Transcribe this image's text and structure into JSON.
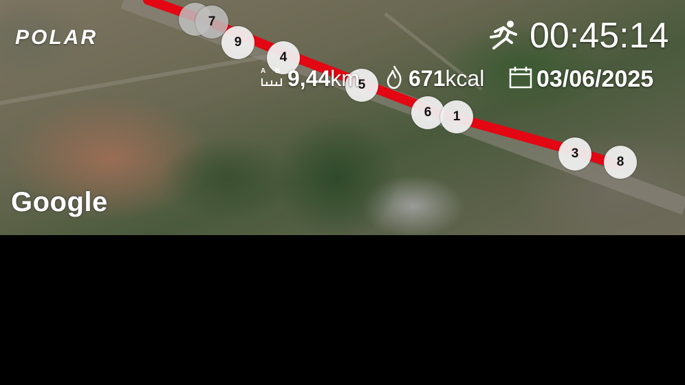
{
  "brand": {
    "logo_text": "POLAR"
  },
  "map": {
    "attribution": "Google",
    "route_color": "#e30613"
  },
  "stats": {
    "duration": "00:45:14",
    "distance_value": "9,44",
    "distance_unit": "km",
    "distance_icon_letters": "A B",
    "calories_value": "671",
    "calories_unit": "kcal",
    "date": "03/06/2025"
  },
  "laps": [
    "7",
    "9",
    "4",
    "5",
    "6",
    "1",
    "3",
    "8"
  ],
  "icons": {
    "duration": "running-person-icon",
    "distance": "ruler-ab-icon",
    "calories": "flame-icon",
    "date": "calendar-icon"
  }
}
